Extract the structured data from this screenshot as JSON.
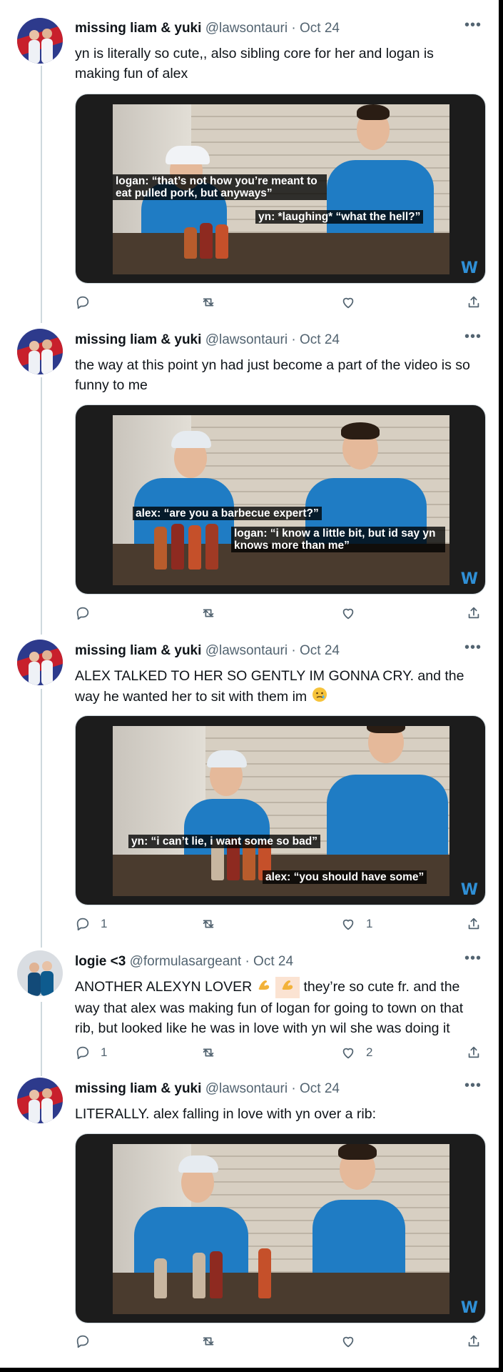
{
  "tweets": [
    {
      "name": "missing liam & yuki",
      "handle": "@lawsontauri",
      "dot": "·",
      "date": "Oct 24",
      "text": "yn is literally so cute,, also sibling core for her and logan is making fun of alex",
      "subtitles": [
        "logan: “that’s not how you’re meant to eat pulled pork, but anyways”",
        "yn: *laughing* “what the hell?”"
      ],
      "reply_count": "",
      "like_count": ""
    },
    {
      "name": "missing liam & yuki",
      "handle": "@lawsontauri",
      "dot": "·",
      "date": "Oct 24",
      "text": "the way at this point yn had just become a part of the video is so funny to me",
      "subtitles": [
        "alex: “are you a barbecue expert?”",
        "logan: “i know a little bit, but id say yn knows more than me”"
      ],
      "reply_count": "",
      "like_count": ""
    },
    {
      "name": "missing liam & yuki",
      "handle": "@lawsontauri",
      "dot": "·",
      "date": "Oct 24",
      "text_line1": "ALEX TALKED TO HER SO GENTLY IM GONNA CRY. and the",
      "text_line2": "way he wanted her to sit with them im",
      "subtitles": [
        "yn: “i can’t lie, i want some so bad”",
        "alex: “you should have some”"
      ],
      "reply_count": "1",
      "like_count": "1"
    },
    {
      "name": "logie <3",
      "handle": "@formulasargeant",
      "dot": "·",
      "date": "Oct 24",
      "text_pre": "ANOTHER ALEXYN LOVER",
      "text_post": "they’re so cute fr. and the way that alex was making fun of logan for going to town on that rib, but looked like he was in love with yn wil she was doing it",
      "reply_count": "1",
      "like_count": "2"
    },
    {
      "name": "missing liam & yuki",
      "handle": "@lawsontauri",
      "dot": "·",
      "date": "Oct 24",
      "text": "LITERALLY. alex falling in love with yn over a rib:",
      "subtitles": [],
      "reply_count": "",
      "like_count": ""
    }
  ],
  "media_logo": "W",
  "icons": [
    "reply-icon",
    "retweet-icon",
    "like-icon",
    "share-icon",
    "more-icon"
  ],
  "colors": {
    "secondary_text": "#536471",
    "thread_line": "#cfd9de",
    "team_blue": "#1f7cc4"
  }
}
